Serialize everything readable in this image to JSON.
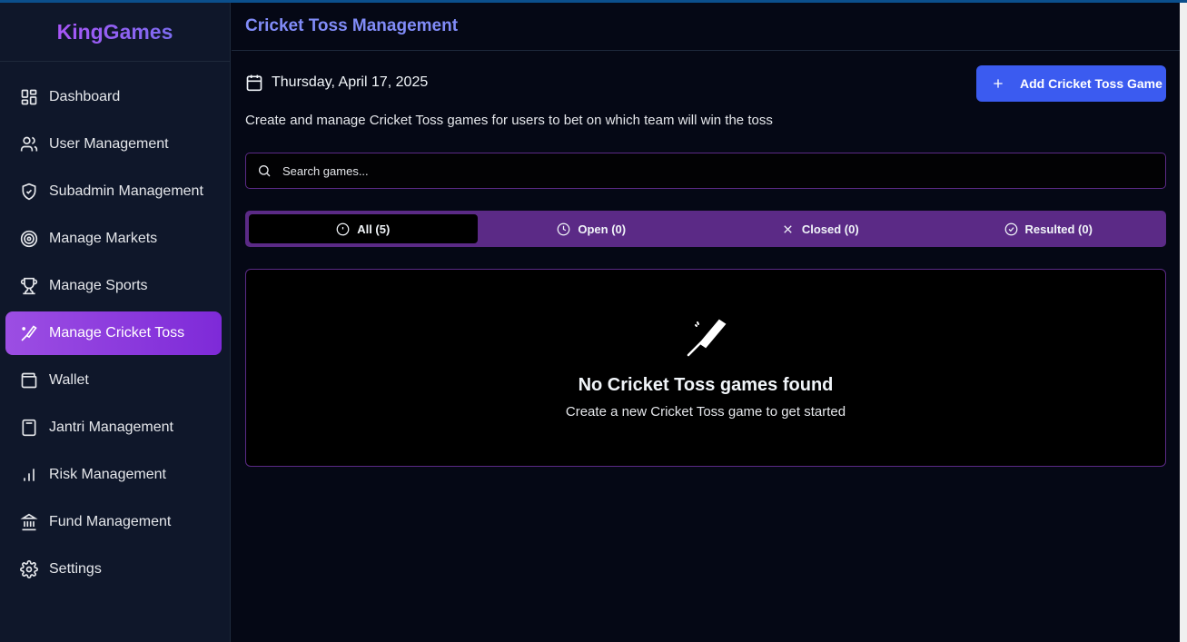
{
  "brand": "KingGames",
  "sidebar": {
    "items": [
      {
        "label": "Dashboard",
        "icon": "dashboard-icon"
      },
      {
        "label": "User Management",
        "icon": "users-icon"
      },
      {
        "label": "Subadmin Management",
        "icon": "shield-icon"
      },
      {
        "label": "Manage Markets",
        "icon": "target-icon"
      },
      {
        "label": "Manage Sports",
        "icon": "trophy-icon"
      },
      {
        "label": "Manage Cricket Toss",
        "icon": "cricket-bat-icon",
        "active": true
      },
      {
        "label": "Wallet",
        "icon": "wallet-icon"
      },
      {
        "label": "Jantri Management",
        "icon": "calculator-icon"
      },
      {
        "label": "Risk Management",
        "icon": "bar-chart-icon"
      },
      {
        "label": "Fund Management",
        "icon": "bank-icon"
      },
      {
        "label": "Settings",
        "icon": "gear-icon"
      }
    ]
  },
  "header": {
    "title": "Cricket Toss Management"
  },
  "main": {
    "date": "Thursday, April 17, 2025",
    "add_button": "Add Cricket Toss Game",
    "description": "Create and manage Cricket Toss games for users to bet on which team will win the toss",
    "search_placeholder": "Search games...",
    "tabs": [
      {
        "label": "All (5)",
        "icon": "alert-circle-icon",
        "active": true
      },
      {
        "label": "Open (0)",
        "icon": "clock-icon"
      },
      {
        "label": "Closed (0)",
        "icon": "x-icon"
      },
      {
        "label": "Resulted (0)",
        "icon": "check-circle-icon"
      }
    ],
    "empty": {
      "title": "No Cricket Toss games found",
      "subtitle": "Create a new Cricket Toss game to get started"
    }
  },
  "colors": {
    "background": "#050815",
    "sidebar": "#0f172a",
    "accent_purple": "#9c4ee3",
    "tab_bar": "#5b2a86",
    "button_blue": "#3b5bf0",
    "title_indigo": "#818cf8"
  }
}
